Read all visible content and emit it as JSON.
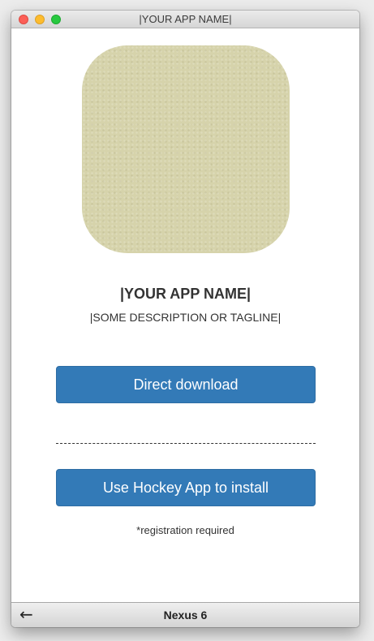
{
  "window": {
    "title": "|YOUR APP NAME|"
  },
  "app": {
    "icon": "app-icon-placeholder",
    "name": "|YOUR APP NAME|",
    "tagline": "|SOME DESCRIPTION OR TAGLINE|"
  },
  "actions": {
    "direct_download_label": "Direct download",
    "hockey_install_label": "Use Hockey App to install",
    "registration_note": "*registration required"
  },
  "device_bar": {
    "back_icon": "back-arrow-icon",
    "back_glyph": "←",
    "device_name": "Nexus 6"
  },
  "colors": {
    "button_primary": "#337ab7",
    "icon_fill": "#d6d3ab",
    "close": "#fc5f57",
    "minimize": "#fdbc2e",
    "zoom": "#28c940"
  }
}
